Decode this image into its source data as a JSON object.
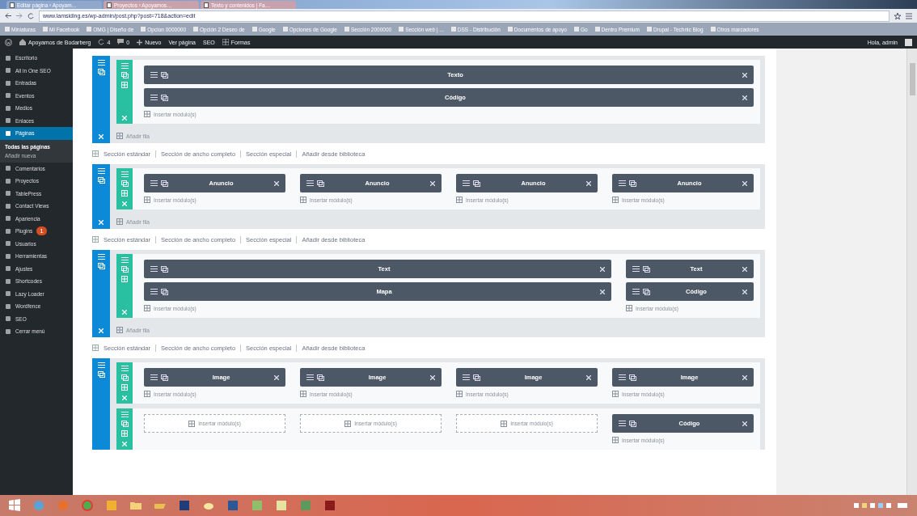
{
  "browser": {
    "tabs": [
      {
        "title": "Editar página ‹ Apoyam…",
        "selected": true
      },
      {
        "title": "Proyectos ‹ Apoyamos…",
        "selected": false
      },
      {
        "title": "Texto y contenidos | Fa…",
        "selected": false
      }
    ],
    "url": "www.lamsiding.es/wp-admin/post.php?post=718&action=edit",
    "bookmarks": [
      "Miniaturas",
      "Mi Facebook",
      "OMG | Diseño de",
      "Opcion 0000000",
      "Opción 2 Deseo de",
      "Google",
      "Opciones de Google",
      "Sección 2000000",
      "Sección web | ...",
      "DSS - Distribución",
      "Documentos de apoyo",
      "Go",
      "Dentro Premium",
      "Drupal - Technic Blog",
      "Otros marcadores"
    ]
  },
  "admin_bar": {
    "site": "Apoyamos de Bodarberg",
    "updates": "4",
    "comments": "0",
    "new": "Nuevo",
    "view": "Ver página",
    "seo": "SEO",
    "extra": "Formas",
    "greeting": "Hola, admin"
  },
  "sidebar": {
    "items": [
      {
        "label": "Escritorio",
        "selected": false
      },
      {
        "label": "All in One SEO",
        "selected": false
      },
      {
        "label": "Entradas",
        "selected": false
      },
      {
        "label": "Eventos",
        "selected": false
      },
      {
        "label": "Medios",
        "selected": false
      },
      {
        "label": "Enlaces",
        "selected": false
      },
      {
        "label": "Páginas",
        "selected": true,
        "children": [
          {
            "label": "Todas las páginas",
            "selected": true
          },
          {
            "label": "Añadir nueva",
            "selected": false
          }
        ]
      },
      {
        "label": "Comentarios",
        "selected": false
      },
      {
        "label": "Proyectos",
        "selected": false
      },
      {
        "label": "TablePress",
        "selected": false
      },
      {
        "label": "Contact Views",
        "selected": false
      },
      {
        "label": "Apariencia",
        "selected": false
      },
      {
        "label": "Plugins",
        "selected": false,
        "badge": "1"
      },
      {
        "label": "Usuarios",
        "selected": false
      },
      {
        "label": "Herramientas",
        "selected": false
      },
      {
        "label": "Ajustes",
        "selected": false
      },
      {
        "label": "Shortcodes",
        "selected": false
      },
      {
        "label": "Lazy Loader",
        "selected": false
      },
      {
        "label": "Wordfence",
        "selected": false
      },
      {
        "label": "SEO",
        "selected": false
      },
      {
        "label": "Cerrar menú",
        "selected": false
      }
    ]
  },
  "sections": [
    {
      "rows": [
        {
          "columns": [
            {
              "kind": "full",
              "modules": [
                "Texto",
                "Código"
              ],
              "insert": "Insertar módulo(s)"
            }
          ]
        }
      ],
      "add_row": "Añadir fila",
      "links": [
        "Sección estándar",
        "Sección de ancho completo",
        "Sección especial",
        "Añadir desde biblioteca"
      ]
    },
    {
      "rows": [
        {
          "columns": [
            {
              "kind": "quarter",
              "modules": [
                "Anuncio"
              ],
              "insert": "Insertar módulo(s)"
            },
            {
              "kind": "quarter",
              "modules": [
                "Anuncio"
              ],
              "insert": "Insertar módulo(s)"
            },
            {
              "kind": "quarter",
              "modules": [
                "Anuncio"
              ],
              "insert": "Insertar módulo(s)"
            },
            {
              "kind": "quarter",
              "modules": [
                "Anuncio"
              ],
              "insert": "Insertar módulo(s)"
            }
          ]
        }
      ],
      "add_row": "Añadir fila",
      "links": [
        "Sección estándar",
        "Sección de ancho completo",
        "Sección especial",
        "Añadir desde biblioteca"
      ]
    },
    {
      "rows": [
        {
          "columns": [
            {
              "kind": "three-quarter",
              "modules": [
                "Text",
                "Mapa"
              ],
              "insert": "Insertar módulo(s)"
            },
            {
              "kind": "quarter",
              "modules": [
                "Text",
                "Código"
              ],
              "insert": "Insertar módulo(s)"
            }
          ]
        }
      ],
      "add_row": "Añadir fila",
      "links": [
        "Sección estándar",
        "Sección de ancho completo",
        "Sección especial",
        "Añadir desde biblioteca"
      ]
    },
    {
      "rows": [
        {
          "columns": [
            {
              "kind": "quarter",
              "modules": [
                "Image"
              ],
              "insert": "Insertar módulo(s)"
            },
            {
              "kind": "quarter",
              "modules": [
                "Image"
              ],
              "insert": "Insertar módulo(s)"
            },
            {
              "kind": "quarter",
              "modules": [
                "Image"
              ],
              "insert": "Insertar módulo(s)"
            },
            {
              "kind": "quarter",
              "modules": [
                "Image"
              ],
              "insert": "Insertar módulo(s)"
            }
          ]
        },
        {
          "columns": [
            {
              "kind": "quarter",
              "insert": "Insertar módulo(s)"
            },
            {
              "kind": "quarter",
              "insert": "Insertar módulo(s)"
            },
            {
              "kind": "quarter",
              "insert": "Insertar módulo(s)"
            },
            {
              "kind": "quarter",
              "modules": [
                "Código"
              ],
              "insert": "Insertar módulo(s)"
            }
          ]
        }
      ]
    }
  ]
}
